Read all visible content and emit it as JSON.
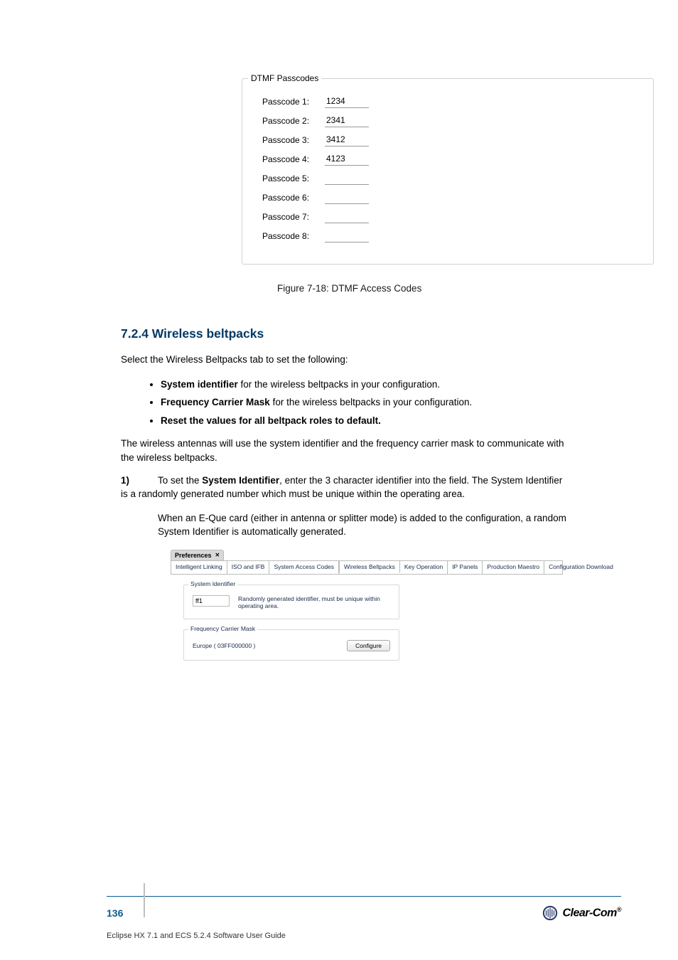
{
  "dtmf": {
    "legend": "DTMF Passcodes",
    "rows": [
      {
        "label": "Passcode 1:",
        "value": "1234"
      },
      {
        "label": "Passcode 2:",
        "value": "2341"
      },
      {
        "label": "Passcode 3:",
        "value": "3412"
      },
      {
        "label": "Passcode 4:",
        "value": "4123"
      },
      {
        "label": "Passcode 5:",
        "value": ""
      },
      {
        "label": "Passcode 6:",
        "value": ""
      },
      {
        "label": "Passcode 7:",
        "value": ""
      },
      {
        "label": "Passcode 8:",
        "value": ""
      }
    ]
  },
  "fig_caption": "Figure 7-18: DTMF Access Codes",
  "section": {
    "heading": "7.2.4 Wireless beltpacks",
    "intro": "Select the Wireless Beltpacks tab to set the following:",
    "bullets": [
      {
        "bold": "System identifier",
        "rest": " for the wireless beltpacks in your configuration."
      },
      {
        "bold": "Frequency Carrier Mask",
        "rest": " for the wireless beltpacks in your configuration."
      },
      {
        "bold": "Reset the values for all beltpack roles to default.",
        "rest": ""
      }
    ],
    "post_bullets": "The wireless antennas will use the system identifier and the frequency carrier mask to communicate with the wireless beltpacks.",
    "step_label": "1)",
    "step_text_lead": "To set the ",
    "step_text_bold": "System Identifier",
    "step_text_tail": ", enter the 3 character identifier into the field. The System Identifier is a randomly generated number which must be unique within the operating area.",
    "step_body": "When an E-Que card (either in antenna or splitter mode) is added to the configuration, a random System Identifier is automatically generated."
  },
  "prefs": {
    "tab_title": "Preferences",
    "tabs": [
      "Intelligent Linking",
      "ISO and IFB",
      "System Access Codes",
      "Wireless Beltpacks",
      "Key Operation",
      "IP Panels",
      "Production Maestro",
      "Configuration Download"
    ],
    "active_tab_index": 3,
    "sysid": {
      "legend": "System Identifier",
      "value": "ff1",
      "desc": "Randomly generated identifier, must be unique within operating area."
    },
    "fcm": {
      "legend": "Frequency Carrier Mask",
      "value": "Europe ( 03FF000000 )",
      "button": "Configure"
    }
  },
  "footer": {
    "page": "136",
    "brand": "Clear-Com",
    "doc": "Eclipse HX 7.1 and ECS 5.2.4 Software User Guide"
  }
}
